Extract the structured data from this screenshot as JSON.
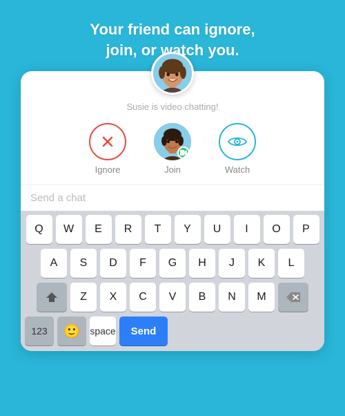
{
  "header": {
    "title": "Your friend can ignore,\njoin, or watch you."
  },
  "card": {
    "status_text": "Susie is video chatting!",
    "actions": [
      {
        "id": "ignore",
        "label": "Ignore"
      },
      {
        "id": "join",
        "label": "Join"
      },
      {
        "id": "watch",
        "label": "Watch"
      }
    ],
    "chat_placeholder": "Send a chat"
  },
  "keyboard": {
    "rows": [
      [
        "Q",
        "W",
        "E",
        "R",
        "T",
        "Y",
        "U",
        "I",
        "O",
        "P"
      ],
      [
        "A",
        "S",
        "D",
        "F",
        "G",
        "H",
        "J",
        "K",
        "L"
      ],
      [
        "Z",
        "X",
        "C",
        "V",
        "B",
        "N",
        "M"
      ]
    ],
    "num_label": "123",
    "space_label": "space",
    "send_label": "Send"
  },
  "colors": {
    "background": "#29b6d8",
    "send_button": "#2d7ff9",
    "ignore_border": "#e74c3c",
    "watch_border": "#29b6d8",
    "join_bg": "#2ecc71"
  }
}
